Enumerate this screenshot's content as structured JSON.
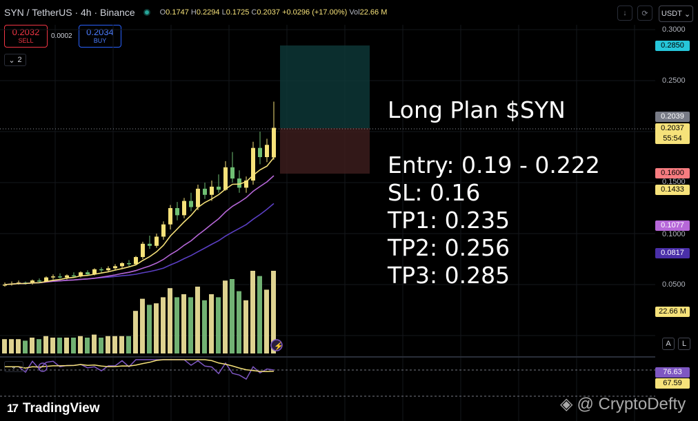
{
  "header": {
    "symbol": "SYN / TetherUS · 4h · Binance",
    "ohlc": {
      "o_label": "O",
      "o": "0.1747",
      "h_label": "H",
      "h": "0.2294",
      "l_label": "L",
      "l": "0.1725",
      "c_label": "C",
      "c": "0.2037",
      "change": "+0.0296 (+17.00%)",
      "vol_label": "Vol",
      "vol": "22.66 M"
    },
    "currency": "USDT"
  },
  "trade": {
    "sell_price": "0.2032",
    "sell_label": "SELL",
    "spread": "0.0002",
    "buy_price": "0.2034",
    "buy_label": "BUY"
  },
  "indicators_collapse_count": "2",
  "price_axis": {
    "ticks": [
      "0.3000",
      "0.2500",
      "0.1500",
      "0.1000",
      "0.0500"
    ],
    "tags": {
      "tp3": {
        "value": "0.2850",
        "color": "#26c6da"
      },
      "last": {
        "value": "0.2039",
        "color": "#787b86"
      },
      "close": {
        "value": "0.2037",
        "color": "#f6e27a"
      },
      "countdown": "55:54",
      "sl": {
        "value": "0.1600",
        "color": "#f77c80"
      },
      "ma_fast": {
        "value": "0.1433",
        "color": "#f6e27a"
      },
      "ma_mid": {
        "value": "0.1077",
        "color": "#b667d8"
      },
      "ma_slow": {
        "value": "0.0817",
        "color": "#6a3fbf"
      },
      "volume": {
        "value": "22.66 M",
        "color": "#f6e27a"
      }
    }
  },
  "rsi_axis": {
    "rsi": {
      "value": "76.63",
      "color": "#7e57c2"
    },
    "rsi_ma": {
      "value": "67.59",
      "color": "#f6e27a"
    }
  },
  "plan": {
    "title": "Long Plan $SYN",
    "entry": "Entry: 0.19 - 0.222",
    "sl": "SL: 0.16",
    "tp1": "TP1: 0.235",
    "tp2": "TP2: 0.256",
    "tp3": "TP3: 0.285"
  },
  "scale_buttons": {
    "auto": "A",
    "log": "L"
  },
  "branding": {
    "logo_mark": "17",
    "logo_text": "TradingView"
  },
  "watermark": "@ CryptoDefty",
  "chart_data": {
    "type": "candlestick",
    "interval": "4h",
    "candles_ohlc_approx": [
      [
        0.05,
        0.052,
        0.048,
        0.05
      ],
      [
        0.05,
        0.053,
        0.049,
        0.051
      ],
      [
        0.051,
        0.054,
        0.05,
        0.052
      ],
      [
        0.052,
        0.053,
        0.05,
        0.051
      ],
      [
        0.051,
        0.055,
        0.05,
        0.054
      ],
      [
        0.054,
        0.056,
        0.052,
        0.053
      ],
      [
        0.053,
        0.058,
        0.052,
        0.057
      ],
      [
        0.057,
        0.06,
        0.055,
        0.058
      ],
      [
        0.058,
        0.061,
        0.056,
        0.057
      ],
      [
        0.057,
        0.06,
        0.055,
        0.059
      ],
      [
        0.059,
        0.062,
        0.057,
        0.058
      ],
      [
        0.058,
        0.063,
        0.057,
        0.062
      ],
      [
        0.062,
        0.064,
        0.059,
        0.06
      ],
      [
        0.06,
        0.066,
        0.059,
        0.065
      ],
      [
        0.065,
        0.067,
        0.062,
        0.064
      ],
      [
        0.064,
        0.068,
        0.062,
        0.066
      ],
      [
        0.066,
        0.07,
        0.064,
        0.068
      ],
      [
        0.068,
        0.072,
        0.066,
        0.071
      ],
      [
        0.071,
        0.074,
        0.068,
        0.07
      ],
      [
        0.07,
        0.078,
        0.069,
        0.077
      ],
      [
        0.077,
        0.092,
        0.075,
        0.09
      ],
      [
        0.09,
        0.098,
        0.085,
        0.088
      ],
      [
        0.088,
        0.1,
        0.086,
        0.097
      ],
      [
        0.097,
        0.112,
        0.094,
        0.109
      ],
      [
        0.109,
        0.128,
        0.104,
        0.125
      ],
      [
        0.125,
        0.131,
        0.113,
        0.118
      ],
      [
        0.118,
        0.135,
        0.115,
        0.132
      ],
      [
        0.132,
        0.14,
        0.122,
        0.126
      ],
      [
        0.126,
        0.148,
        0.123,
        0.144
      ],
      [
        0.144,
        0.15,
        0.134,
        0.138
      ],
      [
        0.138,
        0.152,
        0.132,
        0.146
      ],
      [
        0.146,
        0.158,
        0.14,
        0.143
      ],
      [
        0.143,
        0.171,
        0.142,
        0.165
      ],
      [
        0.165,
        0.18,
        0.15,
        0.154
      ],
      [
        0.154,
        0.162,
        0.14,
        0.145
      ],
      [
        0.145,
        0.156,
        0.14,
        0.152
      ],
      [
        0.152,
        0.19,
        0.148,
        0.184
      ],
      [
        0.184,
        0.2,
        0.168,
        0.175
      ],
      [
        0.175,
        0.193,
        0.17,
        0.187
      ],
      [
        0.1747,
        0.2294,
        0.1725,
        0.2037
      ]
    ],
    "series": [
      {
        "name": "MA fast",
        "last": 0.1433
      },
      {
        "name": "MA mid",
        "last": 0.1077
      },
      {
        "name": "MA slow",
        "last": 0.0817
      }
    ],
    "position": {
      "entry": 0.2037,
      "stop": 0.16,
      "target": 0.285
    },
    "rsi": {
      "last": 76.63,
      "ma_last": 67.59
    },
    "ylim": [
      0.0,
      0.3
    ]
  }
}
